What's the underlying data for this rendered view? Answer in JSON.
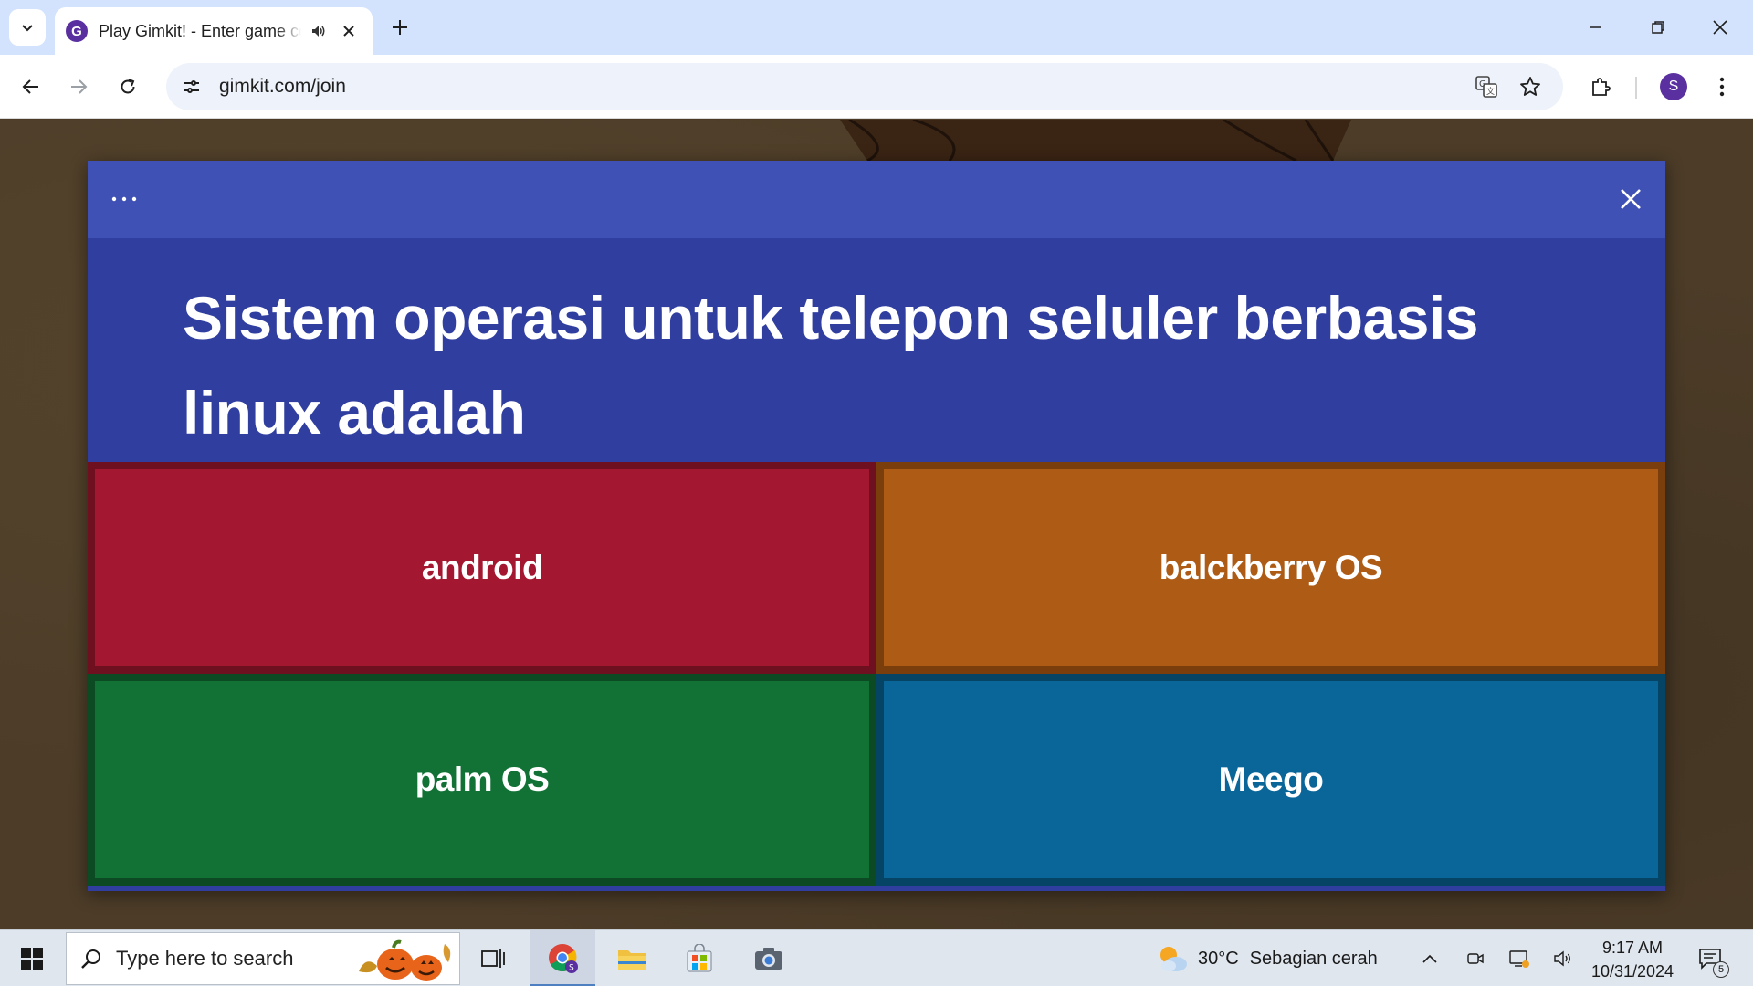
{
  "browser": {
    "tab": {
      "title": "Play Gimkit! - Enter game code"
    },
    "url": "gimkit.com/join",
    "profile_initial": "S"
  },
  "question": {
    "text": "Sistem operasi untuk telepon seluler berbasis linux adalah"
  },
  "answers": [
    {
      "label": "android",
      "color": "#a31830"
    },
    {
      "label": "balckberry OS",
      "color": "#ad5b15"
    },
    {
      "label": "palm OS",
      "color": "#127236"
    },
    {
      "label": "Meego",
      "color": "#0a6699"
    }
  ],
  "theme": {
    "header_color": "#3f51b5",
    "question_bg": "#303f9f"
  },
  "taskbar": {
    "search_placeholder": "Type here to search",
    "weather": {
      "temp": "30°C",
      "condition": "Sebagian cerah"
    },
    "time": "9:17 AM",
    "date": "10/31/2024",
    "notification_count": "5"
  }
}
